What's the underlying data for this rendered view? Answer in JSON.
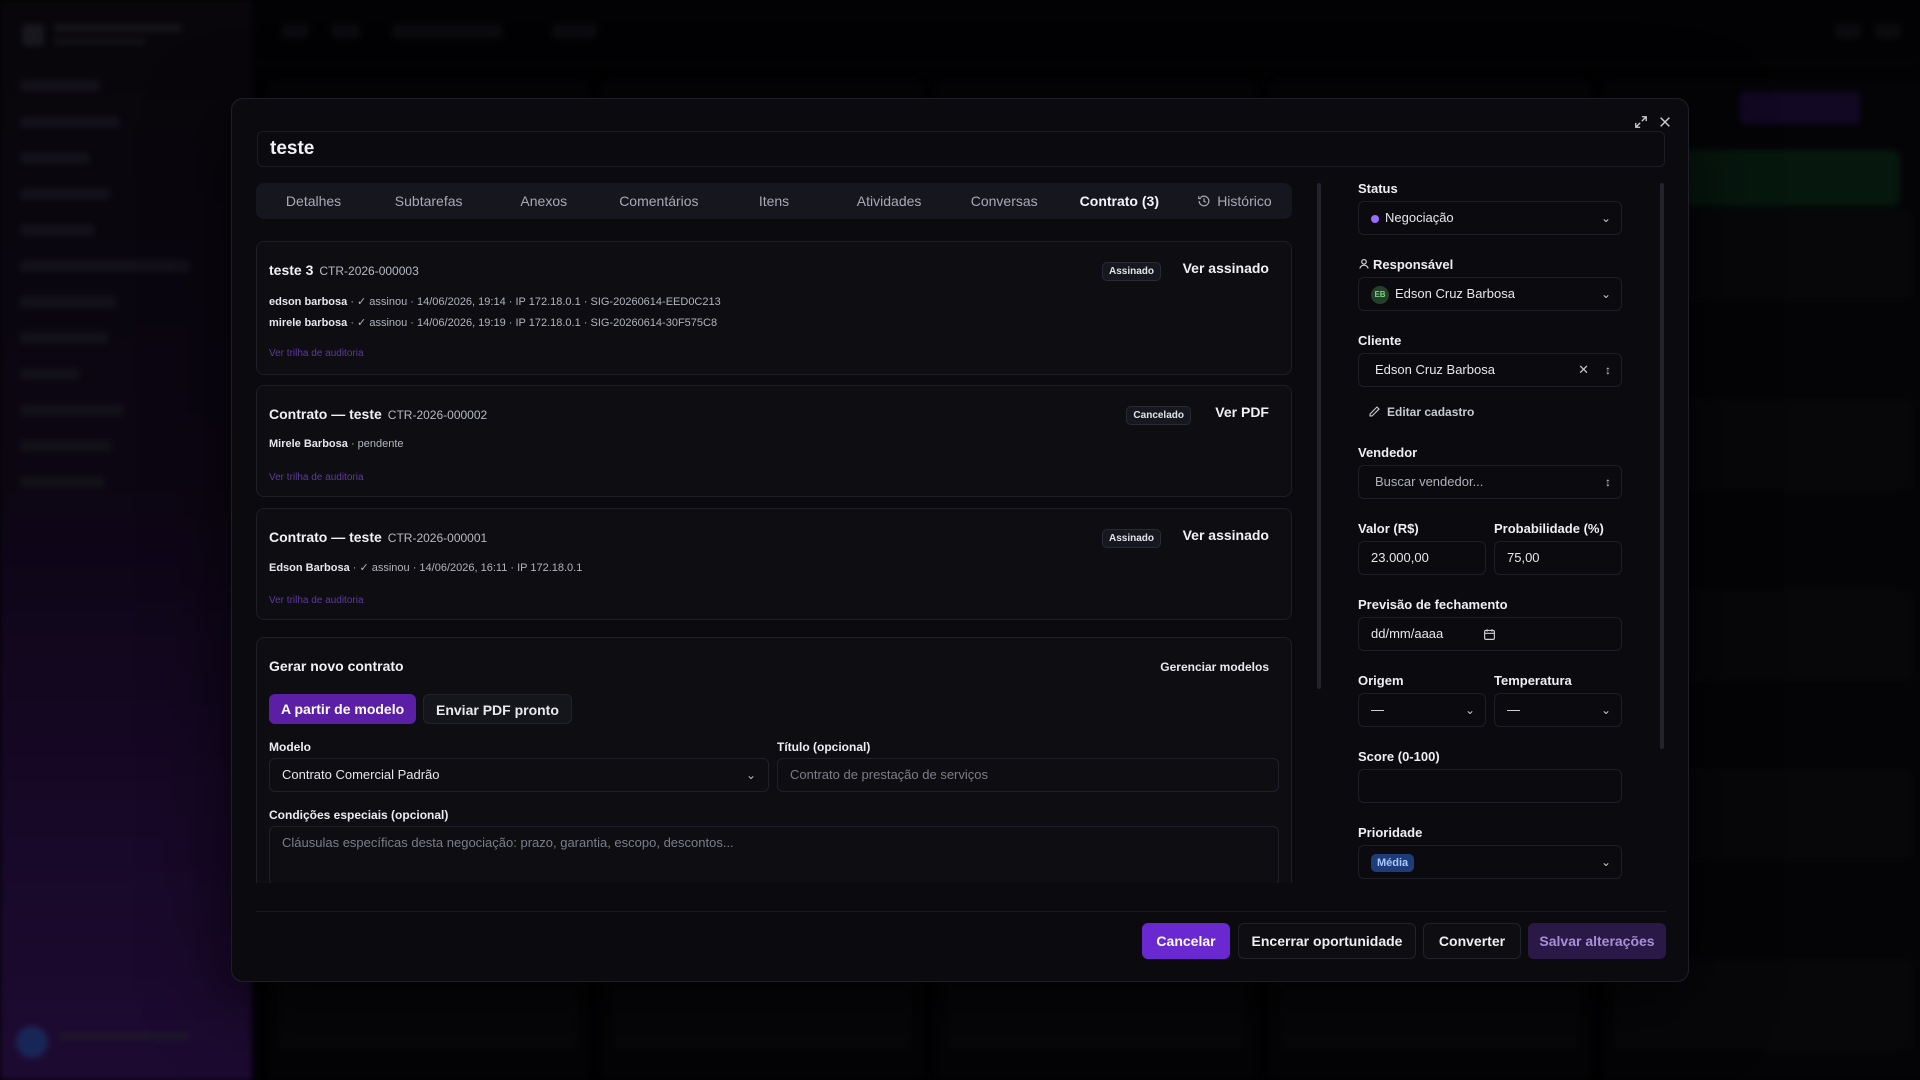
{
  "modal": {
    "title": "teste"
  },
  "tabs": [
    {
      "label": "Detalhes"
    },
    {
      "label": "Subtarefas"
    },
    {
      "label": "Anexos"
    },
    {
      "label": "Comentários"
    },
    {
      "label": "Itens"
    },
    {
      "label": "Atividades"
    },
    {
      "label": "Conversas"
    },
    {
      "label": "Contrato (3)"
    },
    {
      "label": "Histórico"
    }
  ],
  "active_tab": "Contrato (3)",
  "contracts": [
    {
      "title": "teste 3",
      "code": "CTR-2026-000003",
      "status": "Assinado",
      "action": "Ver assinado",
      "signatures": [
        {
          "name": "edson barbosa",
          "detail": "· ✓ assinou  · 14/06/2026, 19:14  · IP 172.18.0.1  · SIG-20260614-EED0C213"
        },
        {
          "name": "mirele barbosa",
          "detail": "· ✓ assinou  · 14/06/2026, 19:19  · IP 172.18.0.1  · SIG-20260614-30F575C8"
        }
      ],
      "audit": "Ver trilha de auditoria"
    },
    {
      "title": "Contrato — teste",
      "code": "CTR-2026-000002",
      "status": "Cancelado",
      "action": "Ver PDF",
      "signatures": [
        {
          "name": "Mirele Barbosa",
          "detail": "· pendente"
        }
      ],
      "audit": "Ver trilha de auditoria"
    },
    {
      "title": "Contrato — teste",
      "code": "CTR-2026-000001",
      "status": "Assinado",
      "action": "Ver assinado",
      "signatures": [
        {
          "name": "Edson Barbosa",
          "detail": "· ✓ assinou  · 14/06/2026, 16:11  · IP 172.18.0.1"
        }
      ],
      "audit": "Ver trilha de auditoria"
    }
  ],
  "generate": {
    "title": "Gerar novo contrato",
    "manage": "Gerenciar modelos",
    "from_model": "A partir de modelo",
    "send_pdf": "Enviar PDF pronto",
    "model_label": "Modelo",
    "model_value": "Contrato Comercial Padrão",
    "title_label": "Título (opcional)",
    "title_placeholder": "Contrato de prestação de serviços",
    "conditions_label": "Condições especiais (opcional)",
    "conditions_placeholder": "Cláusulas específicas desta negociação: prazo, garantia, escopo, descontos..."
  },
  "side": {
    "status_label": "Status",
    "status_value": "Negociação",
    "status_color": "#9b6bff",
    "owner_label": "Responsável",
    "owner_initials": "EB",
    "owner_value": "Edson Cruz Barbosa",
    "client_label": "Cliente",
    "client_value": "Edson Cruz Barbosa",
    "edit_client": "Editar cadastro",
    "seller_label": "Vendedor",
    "seller_placeholder": "Buscar vendedor...",
    "value_label": "Valor (R$)",
    "value_value": "23.000,00",
    "prob_label": "Probabilidade (%)",
    "prob_value": "75,00",
    "close_label": "Previsão de fechamento",
    "close_placeholder": "dd/mm/aaaa",
    "origin_label": "Origem",
    "origin_value": "—",
    "temp_label": "Temperatura",
    "temp_value": "—",
    "score_label": "Score (0-100)",
    "score_value": "",
    "priority_label": "Prioridade",
    "priority_value": "Média"
  },
  "footer": {
    "cancel": "Cancelar",
    "close_opp": "Encerrar oportunidade",
    "convert": "Converter",
    "save": "Salvar alterações"
  }
}
